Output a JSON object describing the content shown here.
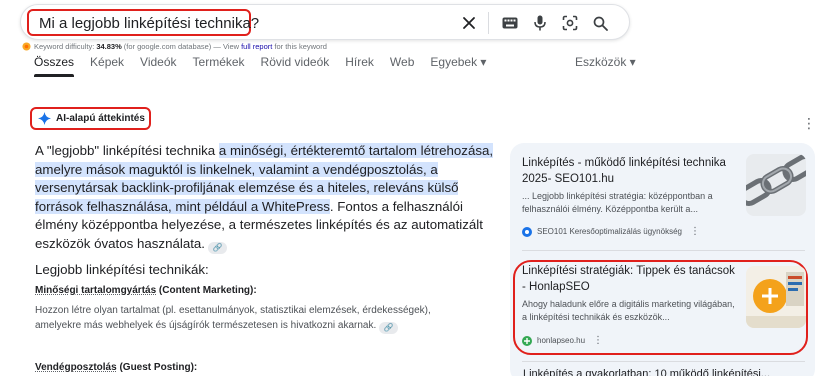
{
  "search": {
    "query": "Mi a legjobb linképítési technika?",
    "icons": [
      "close-icon",
      "keyboard-icon",
      "microphone-icon",
      "lens-icon",
      "search-icon"
    ]
  },
  "keyword_bar": {
    "prefix": "Keyword difficulty:",
    "value": "34.83%",
    "database": "(for google.com database) — View",
    "link": "full report",
    "suffix": "for this keyword"
  },
  "tabs": [
    "Összes",
    "Képek",
    "Videók",
    "Termékek",
    "Rövid videók",
    "Hírek",
    "Web",
    "Egyebek ▾"
  ],
  "tools_label": "Eszközök ▾",
  "ai_overview": {
    "label": "AI-alapú áttekintés",
    "p_lead": "A \"legjobb\" linképítési technika ",
    "p_highlight": "a minőségi, értékteremtő tartalom létrehozása, amelyre mások maguktól is linkelnek, valamint a vendégposztolás, a versenytársak backlink-profiljának elemzése és a hiteles, releváns külső források felhasználása, mint például a WhitePress",
    "p_tail": ". Fontos a felhasználói élmény középpontba helyezése, a természetes linképítés és az automatizált eszközök óvatos használata.",
    "subheading": "Legjobb linképítési technikák:",
    "section1_title_ul": "Minőségi tartalomgyártás",
    "section1_title_rest": " (Content Marketing):",
    "section1_text": "Hozzon létre olyan tartalmat (pl. esettanulmányok, statisztikai elemzések, érdekességek), amelyekre más webhelyek és újságírók természetesen is hivatkozni akarnak.",
    "section2_title_ul": "Vendégposztolás",
    "section2_title_rest": " (Guest Posting):"
  },
  "sources": [
    {
      "title": "Linképítés - működő linképítési technika 2025- SEO101.hu",
      "snippet": "... Legjobb linképítési stratégia: középpontban a felhasználói élmény. Középpontba került a...",
      "source": "SEO101 Keresőoptimalizálás ügynökség"
    },
    {
      "title": "Linképítési stratégiák: Tippek és tanácsok - HonlapSEO",
      "snippet": "Ahogy haladunk előre a digitális marketing világában, a linképítési technikák és eszközök...",
      "source": "honlapseo.hu"
    },
    {
      "title": "Linképítés a gyakorlatban: 10 működő linképítési..."
    }
  ],
  "colors": {
    "highlight": "#d3e3fd",
    "annotation_red": "#e0201c",
    "panel_bg": "#f0f4f9",
    "link_blue": "#1a0dab"
  }
}
